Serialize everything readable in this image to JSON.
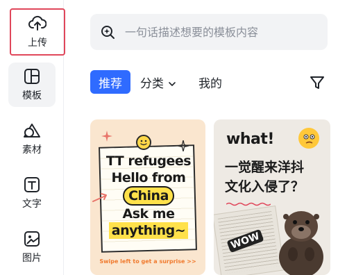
{
  "sidebar": {
    "items": [
      {
        "label": "上传",
        "icon": "cloud-upload-icon"
      },
      {
        "label": "模板",
        "icon": "template-icon"
      },
      {
        "label": "素材",
        "icon": "shapes-icon"
      },
      {
        "label": "文字",
        "icon": "text-icon"
      },
      {
        "label": "图片",
        "icon": "image-icon"
      }
    ]
  },
  "search": {
    "placeholder": "一句话描述想要的模板内容",
    "icon": "ai-search-icon"
  },
  "tabs": {
    "recommended": "推荐",
    "category": "分类",
    "mine": "我的",
    "filter_icon": "filter-icon"
  },
  "colors": {
    "accent": "#2f6bff",
    "highlight_border": "#e0465a"
  },
  "cards": [
    {
      "lines": [
        "TT refugees",
        "Hello from",
        "China",
        "Ask me",
        "anything~"
      ],
      "footer": "Swipe left to get a surprise >>"
    },
    {
      "title": "what!",
      "line1": "一觉醒来洋抖",
      "line2": "文化入侵了？",
      "badge": "WOW"
    }
  ]
}
